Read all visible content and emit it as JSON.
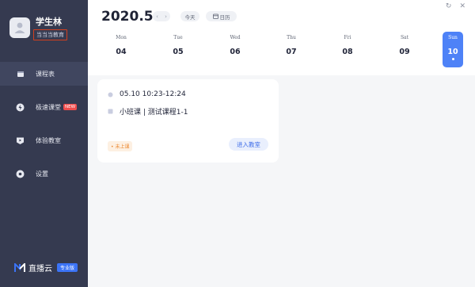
{
  "user": {
    "name": "学生林",
    "school": "当当当教育"
  },
  "nav": [
    {
      "label": "课程表",
      "icon": "schedule-icon",
      "active": true
    },
    {
      "label": "极速课堂",
      "icon": "lightning-icon",
      "badge": "NEW"
    },
    {
      "label": "体验教室",
      "icon": "trial-classroom-icon"
    },
    {
      "label": "设置",
      "icon": "settings-icon"
    }
  ],
  "brand": {
    "name": "直播云",
    "edition": "专业版"
  },
  "header": {
    "month": "2020.5",
    "prev_icon": "chevron-left-icon",
    "next_icon": "chevron-right-icon",
    "today_label": "今天",
    "calendar_label": "日历"
  },
  "window": {
    "refresh_icon": "refresh-icon",
    "close_icon": "close-icon"
  },
  "week": [
    {
      "dow": "Mon",
      "date": "04"
    },
    {
      "dow": "Tue",
      "date": "05"
    },
    {
      "dow": "Wed",
      "date": "06"
    },
    {
      "dow": "Thu",
      "date": "07"
    },
    {
      "dow": "Fri",
      "date": "08"
    },
    {
      "dow": "Sat",
      "date": "09"
    },
    {
      "dow": "Sun",
      "date": "10",
      "active": true
    }
  ],
  "lesson": {
    "datetime": "05.10  10:23-12:24",
    "course": "小班课  |  测试课程1-1",
    "status": "• 未上课",
    "enter_label": "进入教室"
  },
  "colors": {
    "sidebar": "#353a50",
    "accent": "#4e82f7",
    "status_orange": "#ec8a33",
    "badge_red": "#ef4d4d"
  }
}
